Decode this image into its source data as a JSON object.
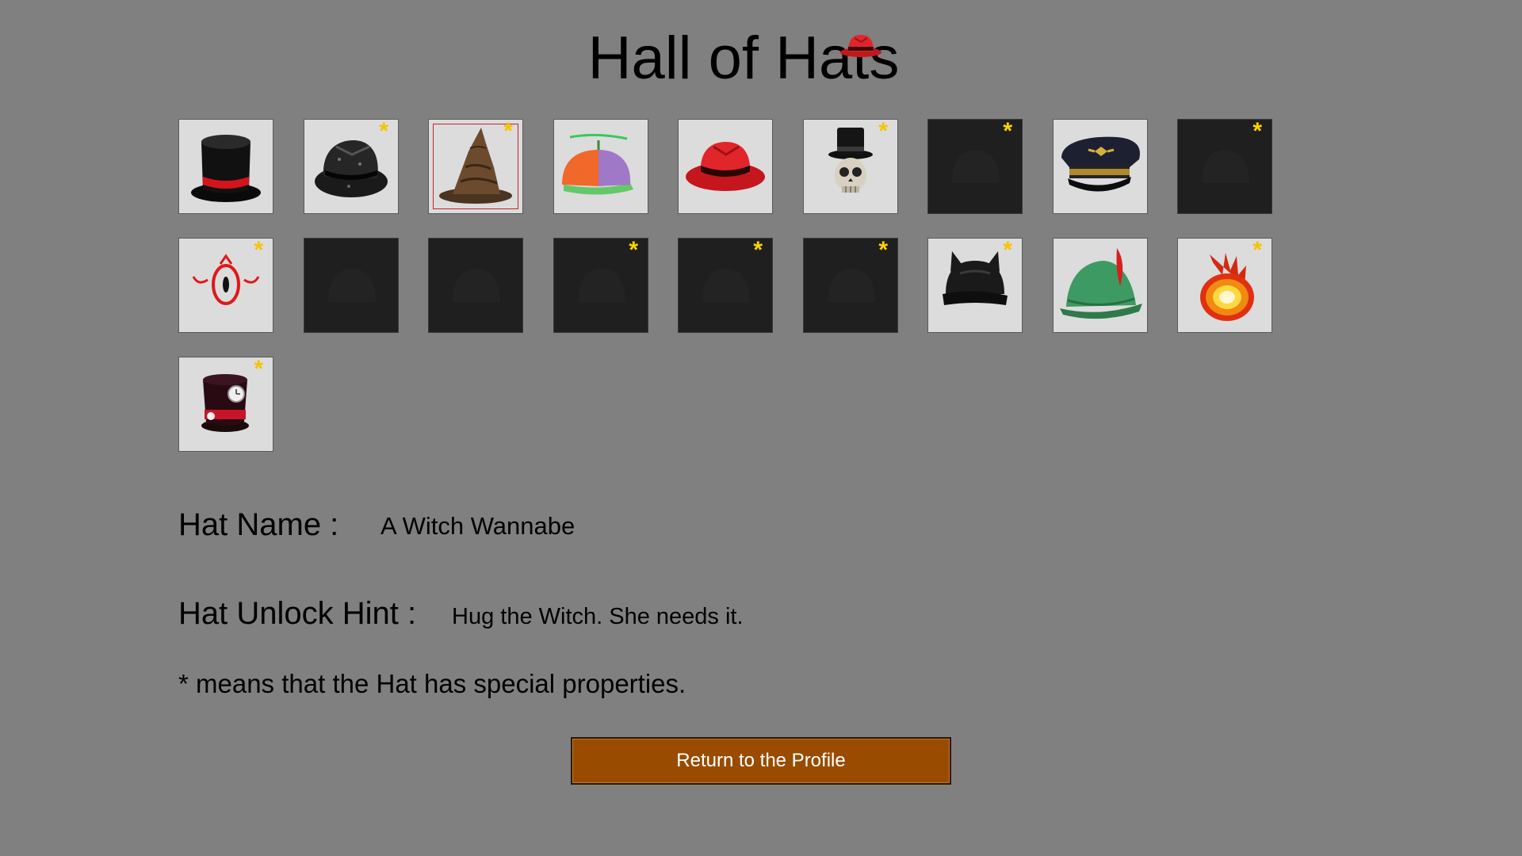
{
  "title": "Hall of Hats",
  "tiles": [
    {
      "hat": "top-hat-red-band-icon",
      "locked": false,
      "special": false,
      "selected": false
    },
    {
      "hat": "sequin-fedora-icon",
      "locked": false,
      "special": true,
      "selected": false
    },
    {
      "hat": "witch-hat-icon",
      "locked": false,
      "special": true,
      "selected": true
    },
    {
      "hat": "propeller-beanie-icon",
      "locked": false,
      "special": false,
      "selected": false
    },
    {
      "hat": "red-fedora-icon",
      "locked": false,
      "special": false,
      "selected": false
    },
    {
      "hat": "skull-top-hat-icon",
      "locked": false,
      "special": true,
      "selected": false
    },
    {
      "hat": "locked-hat-icon",
      "locked": true,
      "special": true,
      "selected": false
    },
    {
      "hat": "officer-cap-icon",
      "locked": false,
      "special": false,
      "selected": false
    },
    {
      "hat": "locked-hat-icon",
      "locked": true,
      "special": true,
      "selected": false
    },
    {
      "hat": "red-eye-icon",
      "locked": false,
      "special": true,
      "selected": false
    },
    {
      "hat": "locked-hat-icon",
      "locked": true,
      "special": false,
      "selected": false
    },
    {
      "hat": "locked-hat-icon",
      "locked": true,
      "special": false,
      "selected": false
    },
    {
      "hat": "locked-hat-icon",
      "locked": true,
      "special": true,
      "selected": false
    },
    {
      "hat": "locked-hat-icon",
      "locked": true,
      "special": true,
      "selected": false
    },
    {
      "hat": "locked-hat-icon",
      "locked": true,
      "special": true,
      "selected": false
    },
    {
      "hat": "bat-helmet-icon",
      "locked": false,
      "special": true,
      "selected": false
    },
    {
      "hat": "green-feather-hat-icon",
      "locked": false,
      "special": false,
      "selected": false
    },
    {
      "hat": "fireball-icon",
      "locked": false,
      "special": true,
      "selected": false
    },
    {
      "hat": "clock-top-hat-icon",
      "locked": false,
      "special": true,
      "selected": false
    }
  ],
  "star_symbol": "*",
  "hat_name_label": "Hat Name :",
  "hat_name_value": "A Witch Wannabe",
  "hint_label": "Hat Unlock Hint :",
  "hint_value": "Hug the Witch. She needs it.",
  "special_note": "* means that the Hat has special properties.",
  "return_button": "Return to the Profile",
  "colors": {
    "background": "#808080",
    "tile": "#dcdcdc",
    "locked_tile": "#1f1f1f",
    "star": "#f5c400",
    "selection": "#c0262c",
    "button": "#994c00"
  }
}
